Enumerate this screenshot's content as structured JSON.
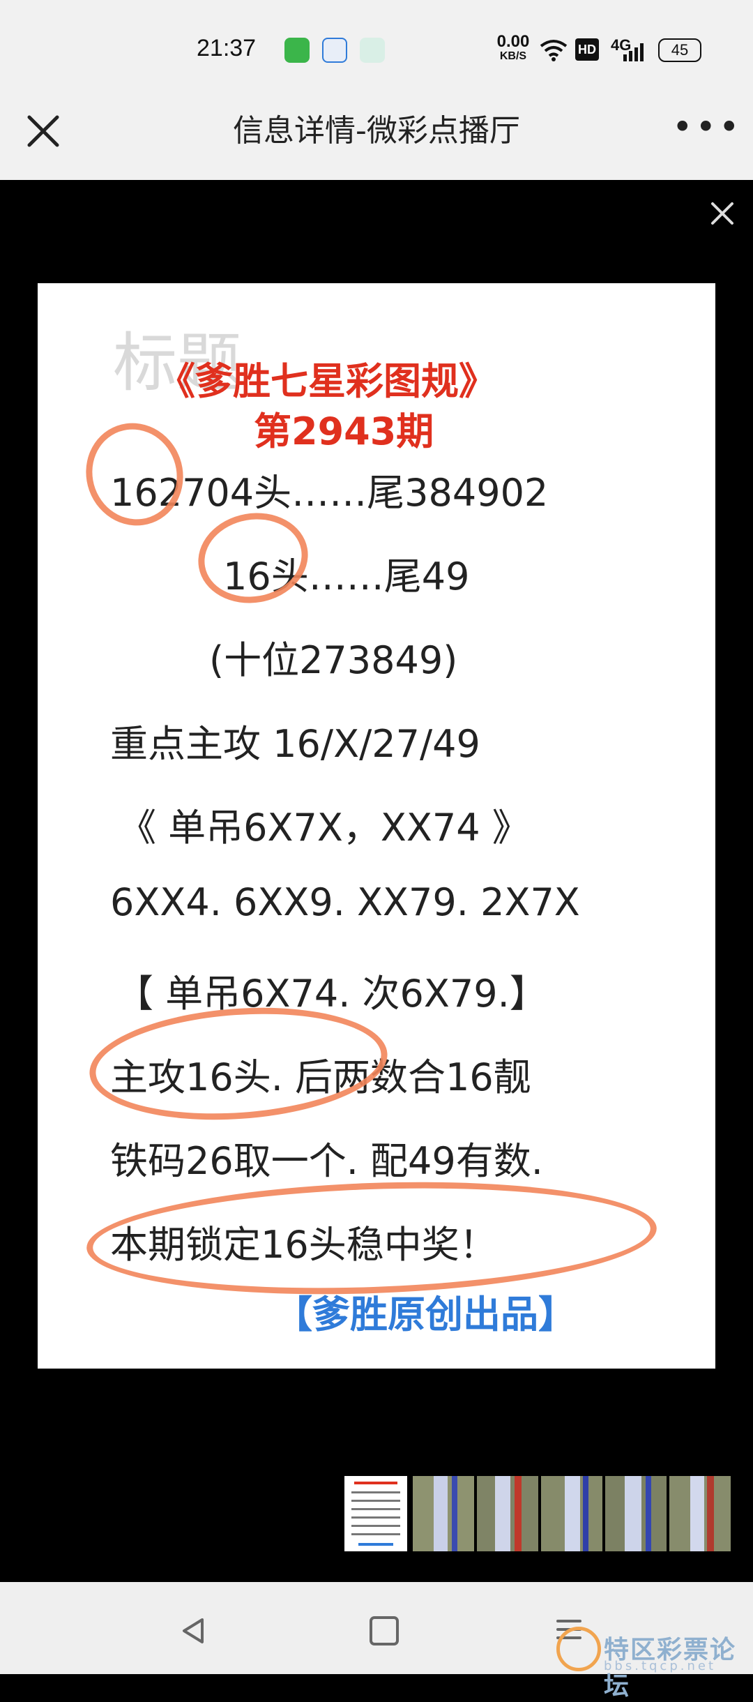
{
  "status_bar": {
    "time": "21:37",
    "net_speed_value": "0.00",
    "net_speed_unit": "KB/S",
    "hd": "HD",
    "signal": "4G",
    "battery": "45"
  },
  "header": {
    "close_icon": "close-icon",
    "title": "信息详情-微彩点播厅",
    "more_icon": "more-icon",
    "more_label": "•••"
  },
  "viewer": {
    "close_icon": "close-icon"
  },
  "poster": {
    "watermark": "标题",
    "title": "《爹胜七星彩图规》",
    "issue": "第2943期",
    "lines": [
      "162704头……尾384902",
      "16头……尾49",
      "(十位273849)",
      "重点主攻 16/X/27/49",
      "《 单吊6X7X，XX74 》",
      "6XX4. 6XX9. XX79. 2X7X",
      "【 单吊6X74. 次6X79.】",
      "主攻16头. 后两数合16靓",
      "铁码26取一个. 配49有数.",
      "本期锁定16头稳中奖！"
    ],
    "footer": "【爹胜原创出品】"
  },
  "navbar": {
    "back_icon": "back-triangle-icon",
    "home_icon": "home-square-icon",
    "menu_icon": "menu-icon"
  },
  "forum_watermark": {
    "text": "特区彩票论坛",
    "sub": "bbs.tqcp.net"
  },
  "colors": {
    "accent_red": "#e0301e",
    "circle_orange": "#f2855a",
    "footer_blue": "#2f7bd9"
  }
}
